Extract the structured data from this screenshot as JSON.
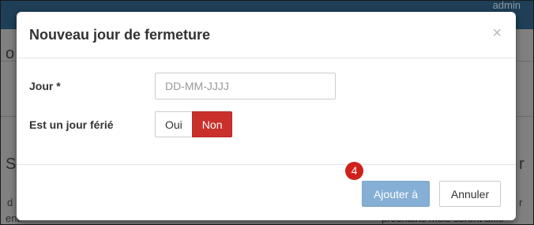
{
  "background": {
    "user_label": "admin",
    "fragment_left_heading": "S",
    "fragment_left_top": "o",
    "fragment_right_heading": "r",
    "fragment_left_small": "d",
    "fragment_left_bottom": "ent.",
    "fragment_right_small": "r",
    "fragment_right_bottom": "prochains mois seront affic"
  },
  "modal": {
    "title": "Nouveau jour de fermeture",
    "close_symbol": "×",
    "fields": {
      "day_label": "Jour *",
      "day_placeholder": "DD-MM-JJJJ",
      "holiday_label": "Est un jour férié",
      "holiday_options": [
        "Oui",
        "Non"
      ],
      "holiday_selected": "Non"
    },
    "footer": {
      "add_label": "Ajouter à",
      "cancel_label": "Annuler"
    }
  },
  "step_marker": "4",
  "colors": {
    "navbar": "#1e3f57",
    "active_toggle": "#c9302c",
    "primary_button": "#85afd4",
    "step_marker": "#d0201c"
  }
}
